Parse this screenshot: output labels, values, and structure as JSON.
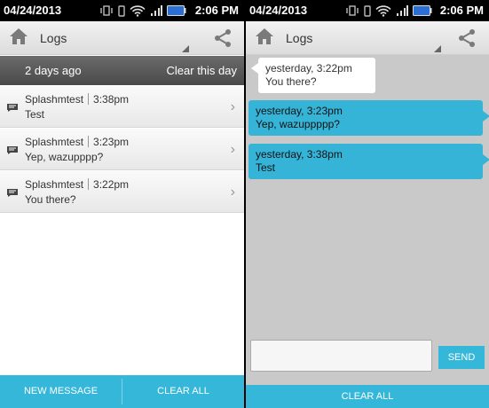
{
  "left": {
    "status": {
      "date": "04/24/2013",
      "time": "2:06 PM"
    },
    "actionbar": {
      "title": "Logs",
      "home_icon": "home-icon",
      "share_icon": "share-icon"
    },
    "section": {
      "label": "2 days ago",
      "clear_label": "Clear this day"
    },
    "logs": [
      {
        "contact": "Splashmtest",
        "time": "3:38pm",
        "message": "Test"
      },
      {
        "contact": "Splashmtest",
        "time": "3:23pm",
        "message": "Yep, wazupppp?"
      },
      {
        "contact": "Splashmtest",
        "time": "3:22pm",
        "message": "You there?"
      }
    ],
    "bottom": {
      "new_message": "NEW MESSAGE",
      "clear_all": "CLEAR ALL"
    }
  },
  "right": {
    "status": {
      "date": "04/24/2013",
      "time": "2:06 PM"
    },
    "actionbar": {
      "title": "Logs"
    },
    "messages": [
      {
        "direction": "incoming",
        "timestamp": "yesterday, 3:22pm",
        "text": "You there?"
      },
      {
        "direction": "outgoing",
        "timestamp": "yesterday, 3:23pm",
        "text": "Yep, wazuppppp?"
      },
      {
        "direction": "outgoing",
        "timestamp": "yesterday, 3:38pm",
        "text": "Test"
      }
    ],
    "compose": {
      "value": "",
      "placeholder": ""
    },
    "send_label": "SEND",
    "clear_all": "CLEAR ALL"
  },
  "colors": {
    "accent": "#35b7d9",
    "status_bar": "#000000",
    "chat_background": "#c9c9c9"
  }
}
